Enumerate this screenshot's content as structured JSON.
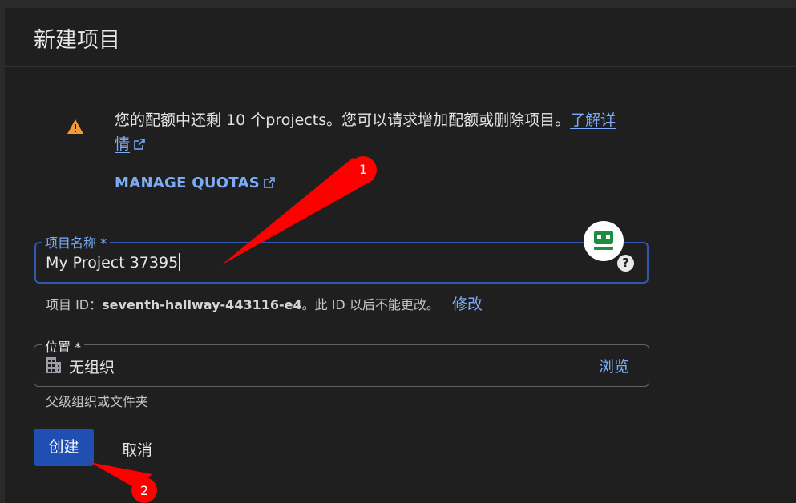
{
  "header": {
    "title": "新建项目"
  },
  "quota_notice": {
    "text": "您的配额中还剩 10 个projects。您可以请求增加配额或删除项目。",
    "learn_more_part1": "了解详",
    "learn_more_part2": "情",
    "manage_quotas": "MANAGE QUOTAS"
  },
  "project_name": {
    "label": "项目名称 *",
    "value": "My Project 37395"
  },
  "project_id": {
    "prefix": "项目 ID：",
    "value": "seventh-hallway-443116-e4",
    "suffix": "。此 ID 以后不能更改。",
    "edit": "修改"
  },
  "location": {
    "label": "位置 *",
    "value": "无组织",
    "browse": "浏览",
    "helper": "父级组织或文件夹"
  },
  "actions": {
    "create": "创建",
    "cancel": "取消"
  },
  "annotations": [
    "1",
    "2"
  ],
  "colors": {
    "background": "#1f1f1f",
    "accent_link": "#7cacf8",
    "focus_border": "#2f58b0",
    "primary_button": "#1f4fb0",
    "warning": "#f29a38",
    "annotation_arrow": "#ff0000"
  },
  "icons": [
    "warning-icon",
    "external-link-icon",
    "robot-extension-icon",
    "help-icon",
    "building-icon"
  ]
}
